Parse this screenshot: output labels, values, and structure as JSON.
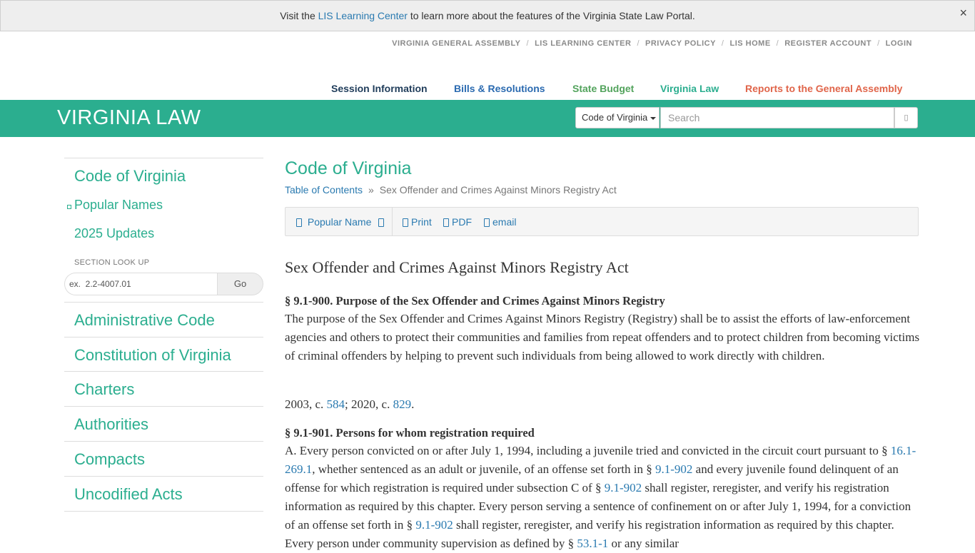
{
  "notice": {
    "prefix": "Visit the ",
    "link": "LIS Learning Center",
    "suffix": " to learn more about the features of the Virginia State Law Portal.",
    "close": "×"
  },
  "utility_links": [
    "VIRGINIA GENERAL ASSEMBLY",
    "LIS LEARNING CENTER",
    "PRIVACY POLICY",
    "LIS HOME",
    "REGISTER ACCOUNT",
    "LOGIN"
  ],
  "utility_sep": "/",
  "main_nav": [
    {
      "label": "Session Information",
      "color": "#1f3c5a"
    },
    {
      "label": "Bills & Resolutions",
      "color": "#2a6ab0"
    },
    {
      "label": "State Budget",
      "color": "#52a35c"
    },
    {
      "label": "Virginia Law",
      "color": "#2bae8f"
    },
    {
      "label": "Reports to the General Assembly",
      "color": "#e0654a"
    }
  ],
  "header": {
    "title": "VIRGINIA LAW",
    "search_scope": "Code of Virginia",
    "search_placeholder": "Search",
    "brand_color": "#2bae8f"
  },
  "sidebar": {
    "code_of_virginia": "Code of Virginia",
    "popular_names": "Popular Names",
    "updates": "2025 Updates",
    "lookup_label": "SECTION LOOK UP",
    "lookup_placeholder": "ex.  2.2-4007.01",
    "go": "Go",
    "items": [
      "Administrative Code",
      "Constitution of Virginia",
      "Charters",
      "Authorities",
      "Compacts",
      "Uncodified Acts"
    ]
  },
  "content": {
    "title": "Code of Virginia",
    "breadcrumb": [
      "Table of Contents",
      "Sex Offender and Crimes Against Minors Registry Act"
    ],
    "breadcrumb_sep": "»",
    "toolbar": {
      "popular_name": "Popular Name",
      "print": "Print",
      "pdf": "PDF",
      "email": "email"
    },
    "act_title": "Sex Offender and Crimes Against Minors Registry Act",
    "sections": [
      {
        "heading": "§ 9.1-900. Purpose of the Sex Offender and Crimes Against Minors Registry",
        "body": "The purpose of the Sex Offender and Crimes Against Minors Registry (Registry) shall be to assist the efforts of law-enforcement agencies and others to protect their communities and families from repeat offenders and to protect children from becoming victims of criminal offenders by helping to prevent such individuals from being allowed to work directly with children.",
        "history_prefix": "2003, c. ",
        "history_link1": "584",
        "history_mid": "; 2020, c. ",
        "history_link2": "829",
        "history_suffix": "."
      },
      {
        "heading": "§ 9.1-901. Persons for whom registration required",
        "body_parts": [
          "A. Every person convicted on or after July 1, 1994, including a juvenile tried and convicted in the circuit court pursuant to § ",
          "16.1-269.1",
          ", whether sentenced as an adult or juvenile, of an offense set forth in § ",
          "9.1-902",
          " and every juvenile found delinquent of an offense for which registration is required under subsection C of § ",
          "9.1-902",
          " shall register, reregister, and verify his registration information as required by this chapter. Every person serving a sentence of confinement on or after July 1, 1994, for a conviction of an offense set forth in § ",
          "9.1-902",
          " shall register, reregister, and verify his registration information as required by this chapter. Every person under community supervision as defined by § ",
          "53.1-1",
          " or any similar"
        ]
      }
    ]
  }
}
